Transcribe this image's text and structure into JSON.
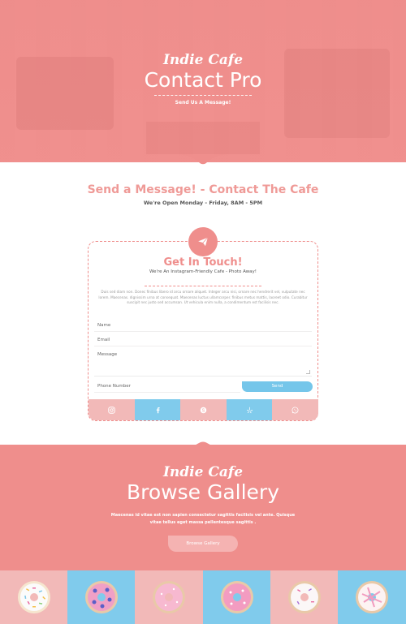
{
  "hero": {
    "brand": "Indie Cafe",
    "title": "Contact Pro",
    "subtitle": "Send Us A Message!"
  },
  "message_section": {
    "title": "Send a Message! - Contact The Cafe",
    "hours": "We're Open Monday - Friday, 8AM - 5PM"
  },
  "contact_card": {
    "icon": "paper-plane-icon",
    "title": "Get In Touch!",
    "subtitle": "We're An Instagram-Friendly Cafe - Photo Away!",
    "body": "Duis sed diam non. Donec finibus libero id arcu ornare aliquet. Integer arcu nisi, ornare nec hendrerit vel, vulputate nec lorem. Maecenas. dignissim urna at consequat. Maecenas luctus ullamcorper. finibus metus mattis, laoreet odio. Curabitur suscipit nec justo sed accumsan. Ut vehicula enim nulla, a condimentum est facilisis nec.",
    "fields": {
      "name_placeholder": "Name",
      "email_placeholder": "Email",
      "message_placeholder": "Message",
      "phone_placeholder": "Phone Number"
    },
    "send_label": "Send",
    "social": [
      "instagram-icon",
      "facebook-icon",
      "skype-icon",
      "yelp-icon",
      "whatsapp-icon"
    ]
  },
  "gallery": {
    "brand": "Indie Cafe",
    "title": "Browse Gallery",
    "description_line1": "Maecenas id vitae  est non sapien consectetur sagittis facilisis vel ante. Quisque",
    "description_line2": "vitae tellus eget massa pellentesque sagittis .",
    "button_label": "Browse Gallery"
  },
  "tiles": [
    "donut-image",
    "donut-image",
    "donut-image",
    "donut-image",
    "donut-image",
    "donut-image"
  ],
  "colors": {
    "accent": "#ef8e8c",
    "light_pink": "#f2b9b8",
    "sky_blue": "#80cbec",
    "send_blue": "#75c6ea"
  }
}
